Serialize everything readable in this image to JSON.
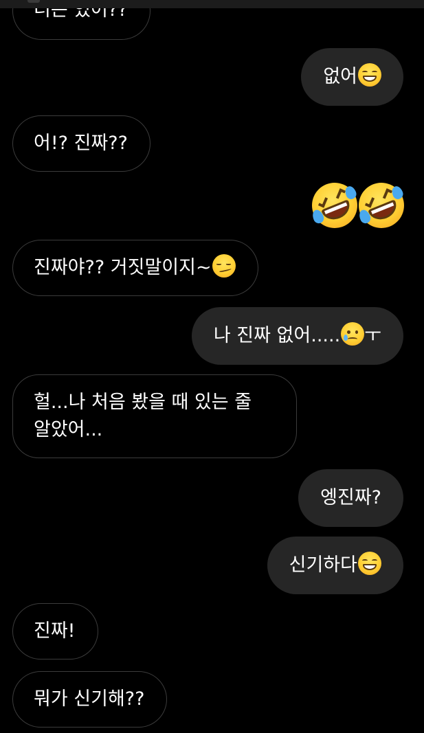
{
  "messages": [
    {
      "id": "m0",
      "side": "in",
      "text": "너는 있어??"
    },
    {
      "id": "m1",
      "side": "out",
      "text": "없어",
      "emoji": "grinning-face-icon"
    },
    {
      "id": "m2",
      "side": "in",
      "text": "어!? 진짜??"
    },
    {
      "id": "m3",
      "side": "out",
      "text": "",
      "emoji": "rolling-laughing-icon",
      "emoji_count": 2
    },
    {
      "id": "m4",
      "side": "in",
      "text": "진짜야?? 거짓말이지~",
      "emoji": "smirking-face-icon"
    },
    {
      "id": "m5",
      "side": "out",
      "text": "나 진짜 없어.....",
      "emoji": "sad-tear-face-icon",
      "suffix": "ㅜ"
    },
    {
      "id": "m6",
      "side": "in",
      "text": "헐...나 처음 봤을 때 있는 줄 알았어..."
    },
    {
      "id": "m7",
      "side": "out",
      "text": "엥진짜?"
    },
    {
      "id": "m8",
      "side": "out",
      "text": "신기하다",
      "emoji": "grinning-face-icon"
    },
    {
      "id": "m9",
      "side": "in",
      "text": "진짜!"
    },
    {
      "id": "m10",
      "side": "in",
      "text": "뭐가 신기해??"
    }
  ],
  "colors": {
    "background": "#000000",
    "incoming_bubble": "#000000",
    "incoming_border": "#3c3c3c",
    "outgoing_bubble": "#262626",
    "text": "#ffffff"
  }
}
